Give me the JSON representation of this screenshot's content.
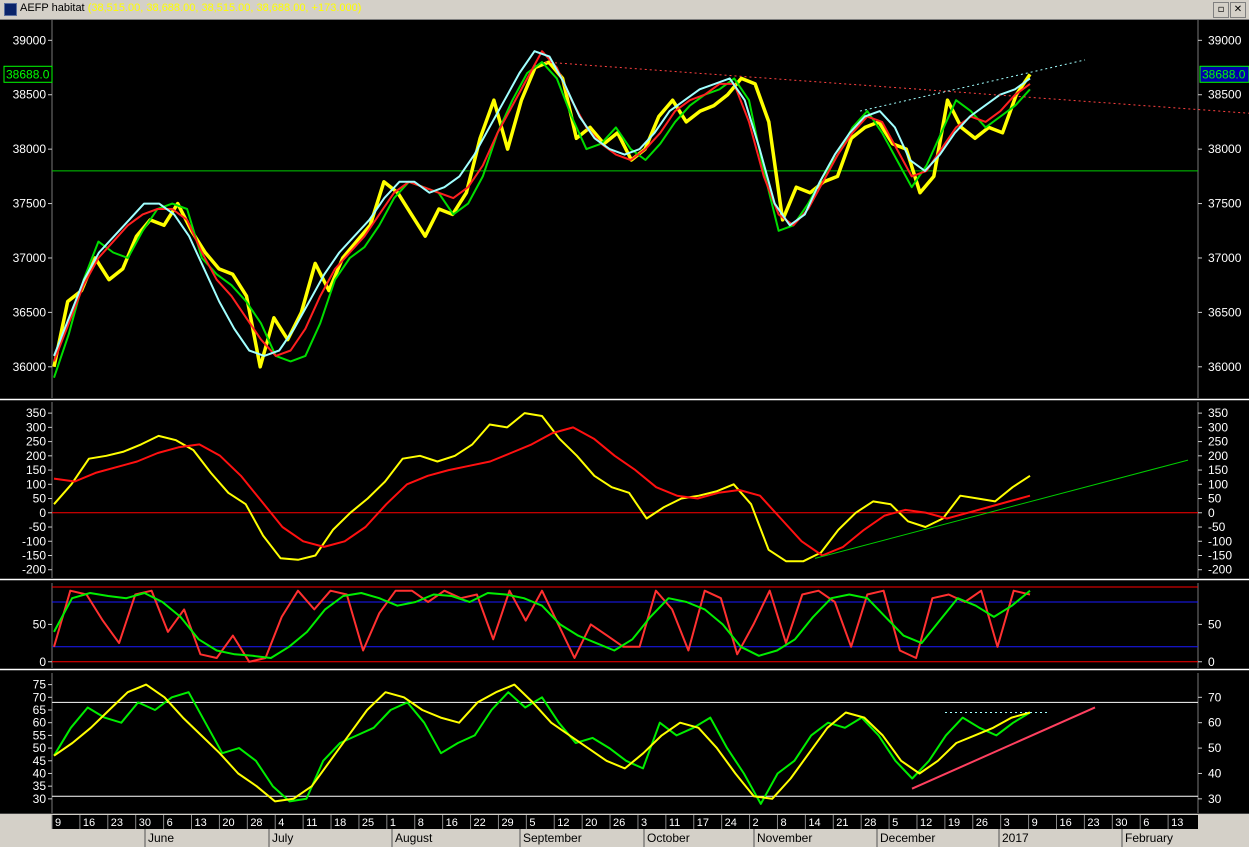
{
  "window": {
    "title": "AEFP habitat",
    "ohlc_readout": "(38,515.00, 38,688.00, 38,515.00, 38,688.00, +173.000)",
    "restore_glyph": "▫",
    "close_glyph": "✕"
  },
  "chart_data": [
    {
      "type": "line",
      "panel": "price",
      "yticks": [
        36000,
        36500,
        37000,
        37500,
        38000,
        38500,
        39000
      ],
      "ylim": [
        35750,
        39150
      ],
      "last_value_label": "38688.0",
      "last_value_label_right": "38688.0",
      "horizontal_line": 37800,
      "series": [
        {
          "color": "#ffff00",
          "values": [
            36000,
            36600,
            36700,
            37000,
            36800,
            36900,
            37200,
            37350,
            37300,
            37500,
            37250,
            37050,
            36900,
            36850,
            36650,
            36000,
            36450,
            36250,
            36500,
            36950,
            36700,
            37000,
            37150,
            37300,
            37700,
            37600,
            37400,
            37200,
            37450,
            37400,
            37600,
            38100,
            38450,
            38000,
            38450,
            38750,
            38800,
            38650,
            38100,
            38200,
            38050,
            38150,
            37900,
            38000,
            38300,
            38450,
            38250,
            38350,
            38400,
            38500,
            38650,
            38600,
            38250,
            37350,
            37650,
            37600,
            37700,
            37750,
            38100,
            38200,
            38250,
            38050,
            38000,
            37600,
            37750,
            38450,
            38200,
            38100,
            38200,
            38150,
            38500,
            38688
          ]
        },
        {
          "color": "#00dd00",
          "values": [
            35900,
            36300,
            36800,
            37150,
            37050,
            37000,
            37250,
            37450,
            37500,
            37450,
            37000,
            36850,
            36750,
            36600,
            36400,
            36100,
            36050,
            36100,
            36400,
            36800,
            37000,
            37100,
            37300,
            37550,
            37700,
            37650,
            37600,
            37400,
            37500,
            37750,
            38150,
            38450,
            38700,
            38800,
            38650,
            38300,
            38000,
            38050,
            38200,
            38000,
            37900,
            38050,
            38250,
            38400,
            38500,
            38550,
            38650,
            38450,
            37800,
            37250,
            37300,
            37500,
            37750,
            37950,
            38200,
            38350,
            38150,
            37900,
            37650,
            37850,
            38150,
            38450,
            38350,
            38200,
            38300,
            38400,
            38550
          ]
        },
        {
          "color": "#ff2020",
          "values": [
            36050,
            36400,
            36750,
            37000,
            37150,
            37300,
            37400,
            37450,
            37450,
            37350,
            37050,
            36800,
            36650,
            36450,
            36250,
            36100,
            36150,
            36350,
            36650,
            36900,
            37050,
            37200,
            37400,
            37600,
            37700,
            37650,
            37600,
            37550,
            37650,
            37850,
            38150,
            38400,
            38650,
            38900,
            38750,
            38450,
            38200,
            38050,
            37950,
            37900,
            38000,
            38150,
            38350,
            38450,
            38500,
            38600,
            38600,
            38250,
            37750,
            37400,
            37300,
            37450,
            37700,
            37950,
            38150,
            38300,
            38250,
            38000,
            37750,
            37800,
            38000,
            38200,
            38300,
            38250,
            38350,
            38500,
            38600
          ]
        },
        {
          "color": "#a0ffff",
          "values": [
            36100,
            36450,
            36800,
            37050,
            37200,
            37350,
            37500,
            37500,
            37400,
            37200,
            36900,
            36600,
            36350,
            36150,
            36100,
            36150,
            36350,
            36600,
            36850,
            37050,
            37200,
            37350,
            37550,
            37700,
            37700,
            37600,
            37650,
            37750,
            37950,
            38200,
            38450,
            38700,
            38900,
            38850,
            38600,
            38300,
            38100,
            38000,
            37950,
            38000,
            38150,
            38350,
            38450,
            38550,
            38600,
            38650,
            38450,
            38000,
            37500,
            37300,
            37400,
            37700,
            37950,
            38150,
            38300,
            38350,
            38200,
            37900,
            37800,
            37950,
            38150,
            38300,
            38400,
            38500,
            38550,
            38650
          ]
        }
      ],
      "trendlines": [
        {
          "color": "#ff4040",
          "style": "dotted",
          "label": "downtrend"
        },
        {
          "color": "#a0ffff",
          "style": "dotted",
          "label": "uptrend"
        }
      ]
    },
    {
      "type": "line",
      "panel": "oscillator",
      "yticks": [
        -200,
        -150,
        -100,
        -50,
        0,
        50,
        100,
        150,
        200,
        250,
        300,
        350
      ],
      "ylim": [
        -215,
        375
      ],
      "zero_line": 0,
      "series": [
        {
          "color": "#ffff00",
          "values": [
            30,
            100,
            190,
            200,
            215,
            240,
            270,
            255,
            220,
            140,
            70,
            30,
            -80,
            -160,
            -165,
            -150,
            -60,
            0,
            50,
            110,
            190,
            200,
            180,
            200,
            240,
            310,
            300,
            350,
            340,
            260,
            200,
            130,
            90,
            70,
            -20,
            20,
            50,
            60,
            75,
            100,
            30,
            -130,
            -170,
            -170,
            -140,
            -60,
            0,
            40,
            30,
            -30,
            -50,
            -20,
            60,
            50,
            40,
            90,
            130
          ]
        },
        {
          "color": "#ff1010",
          "values": [
            120,
            110,
            140,
            160,
            180,
            210,
            230,
            240,
            200,
            130,
            40,
            -50,
            -100,
            -120,
            -100,
            -50,
            30,
            100,
            130,
            150,
            165,
            180,
            210,
            240,
            280,
            300,
            260,
            200,
            150,
            90,
            60,
            50,
            70,
            80,
            60,
            -20,
            -100,
            -150,
            -120,
            -60,
            -10,
            10,
            0,
            -20,
            0,
            20,
            40,
            60
          ]
        }
      ],
      "trendline": {
        "color": "#00cc00",
        "label": "oscillator uptrend"
      }
    },
    {
      "type": "line",
      "panel": "stochastic",
      "yticks": [
        0,
        50
      ],
      "ylim": [
        -3,
        100
      ],
      "bands": [
        20,
        80
      ],
      "series": [
        {
          "color": "#ff3030",
          "values": [
            20,
            95,
            90,
            55,
            25,
            90,
            95,
            40,
            70,
            10,
            5,
            35,
            0,
            5,
            60,
            95,
            70,
            95,
            90,
            15,
            65,
            95,
            95,
            80,
            95,
            85,
            90,
            30,
            95,
            55,
            95,
            50,
            5,
            50,
            35,
            20,
            20,
            95,
            70,
            15,
            95,
            85,
            10,
            50,
            95,
            25,
            90,
            95,
            80,
            20,
            90,
            95,
            15,
            5,
            85,
            90,
            80,
            95,
            20,
            95,
            90
          ]
        },
        {
          "color": "#00ee00",
          "values": [
            40,
            85,
            92,
            88,
            85,
            92,
            80,
            60,
            30,
            15,
            10,
            8,
            5,
            20,
            40,
            70,
            88,
            92,
            85,
            75,
            80,
            90,
            88,
            80,
            92,
            90,
            85,
            75,
            50,
            35,
            25,
            15,
            30,
            60,
            85,
            80,
            70,
            50,
            20,
            8,
            15,
            30,
            60,
            85,
            90,
            85,
            60,
            35,
            25,
            55,
            85,
            75,
            60,
            75,
            95
          ]
        }
      ]
    },
    {
      "type": "line",
      "panel": "rsi",
      "yticks_left": [
        30,
        35,
        40,
        45,
        50,
        55,
        60,
        65,
        70,
        75
      ],
      "yticks_right": [
        30,
        40,
        50,
        60,
        70
      ],
      "ylim": [
        26,
        78
      ],
      "bands": [
        31,
        68
      ],
      "series": [
        {
          "color": "#00ee00",
          "values": [
            47,
            58,
            66,
            62,
            60,
            68,
            65,
            70,
            72,
            60,
            48,
            50,
            45,
            35,
            29,
            30,
            45,
            52,
            55,
            58,
            65,
            68,
            60,
            48,
            52,
            55,
            65,
            72,
            66,
            70,
            60,
            52,
            54,
            50,
            45,
            42,
            60,
            55,
            58,
            62,
            50,
            40,
            28,
            40,
            45,
            55,
            60,
            58,
            62,
            55,
            45,
            38,
            45,
            55,
            62,
            58,
            55,
            60,
            64
          ]
        },
        {
          "color": "#ffff00",
          "values": [
            47,
            52,
            58,
            65,
            72,
            75,
            70,
            62,
            55,
            48,
            40,
            35,
            29,
            30,
            35,
            45,
            55,
            65,
            72,
            70,
            65,
            62,
            60,
            68,
            72,
            75,
            68,
            60,
            55,
            50,
            45,
            42,
            48,
            55,
            60,
            58,
            50,
            40,
            31,
            30,
            38,
            48,
            58,
            64,
            62,
            55,
            45,
            40,
            45,
            52,
            55,
            58,
            62,
            64
          ]
        }
      ],
      "trendline": {
        "color": "#ff4060",
        "label": "rsi support"
      }
    }
  ],
  "x_axis": {
    "day_labels": [
      "9",
      "16",
      "23",
      "30",
      "6",
      "13",
      "20",
      "28",
      "4",
      "11",
      "18",
      "25",
      "1",
      "8",
      "16",
      "22",
      "29",
      "5",
      "12",
      "20",
      "26",
      "3",
      "11",
      "17",
      "24",
      "2",
      "8",
      "14",
      "21",
      "28",
      "5",
      "12",
      "19",
      "26",
      "3",
      "9",
      "16",
      "23",
      "30",
      "6",
      "13"
    ],
    "month_labels": [
      "June",
      "July",
      "August",
      "September",
      "October",
      "November",
      "December",
      "2017",
      "February"
    ]
  }
}
